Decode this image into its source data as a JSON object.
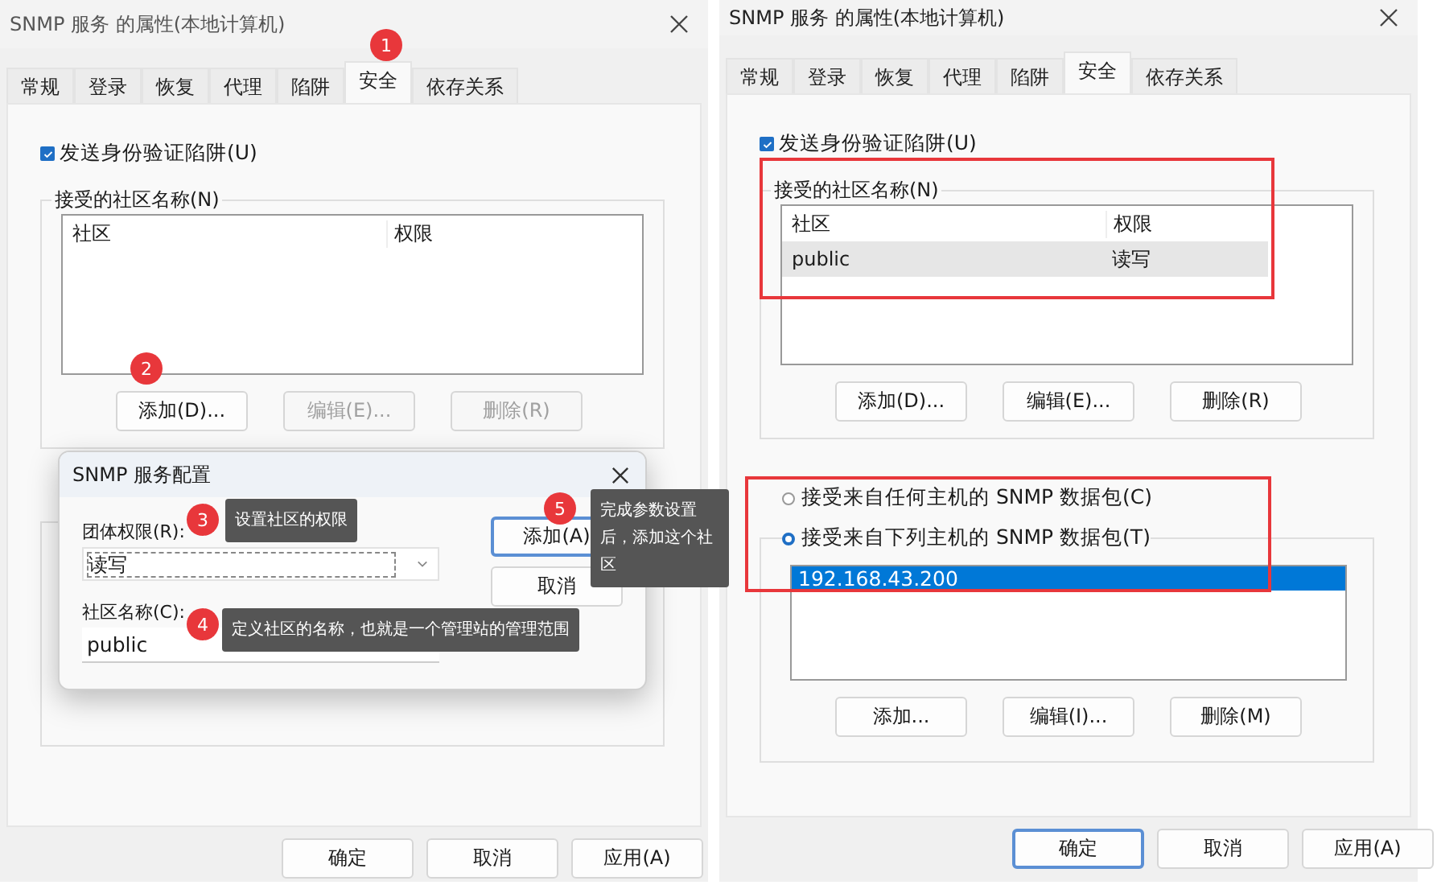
{
  "windows": [
    {
      "title": "SNMP 服务 的属性(本地计算机)",
      "tabs": [
        {
          "label": "常规",
          "selected": false
        },
        {
          "label": "登录",
          "selected": false
        },
        {
          "label": "恢复",
          "selected": false
        },
        {
          "label": "代理",
          "selected": false
        },
        {
          "label": "陷阱",
          "selected": false
        },
        {
          "label": "安全",
          "selected": true
        },
        {
          "label": "依存关系",
          "selected": false
        }
      ],
      "auth_trap": {
        "label": "发送身份验证陷阱(U)",
        "checked": true
      },
      "communities": {
        "label": "接受的社区名称(N)",
        "columns": [
          "社区",
          "权限"
        ]
      },
      "community_buttons": [
        {
          "label": "添加(D)...",
          "disabled": false
        },
        {
          "label": "编辑(E)...",
          "disabled": true
        },
        {
          "label": "删除(R)",
          "disabled": true
        }
      ],
      "footer_buttons": [
        {
          "label": "确定",
          "focused": false
        },
        {
          "label": "取消",
          "focused": false
        },
        {
          "label": "应用(A)",
          "focused": false
        }
      ]
    },
    {
      "title": "SNMP 服务 的属性(本地计算机)",
      "tabs": [
        {
          "label": "常规",
          "selected": false
        },
        {
          "label": "登录",
          "selected": false
        },
        {
          "label": "恢复",
          "selected": false
        },
        {
          "label": "代理",
          "selected": false
        },
        {
          "label": "陷阱",
          "selected": false
        },
        {
          "label": "安全",
          "selected": true
        },
        {
          "label": "依存关系",
          "selected": false
        }
      ],
      "auth_trap": {
        "label": "发送身份验证陷阱(U)",
        "checked": true
      },
      "communities": {
        "label": "接受的社区名称(N)",
        "columns": [
          "社区",
          "权限"
        ],
        "rows": [
          {
            "cells": [
              "public",
              "读写"
            ],
            "selected": true
          }
        ]
      },
      "community_buttons": [
        {
          "label": "添加(D)...",
          "disabled": false
        },
        {
          "label": "编辑(E)...",
          "disabled": false
        },
        {
          "label": "删除(R)",
          "disabled": false
        }
      ],
      "host_filter": {
        "options": [
          {
            "label": "接受来自任何主机的 SNMP 数据包(C)",
            "selected": false
          },
          {
            "label": "接受来自下列主机的 SNMP 数据包(T)",
            "selected": true
          }
        ],
        "hosts": [
          {
            "text": "192.168.43.200",
            "selected": true
          }
        ],
        "buttons": [
          {
            "label": "添加...",
            "disabled": false
          },
          {
            "label": "编辑(I)...",
            "disabled": false
          },
          {
            "label": "删除(M)",
            "disabled": false
          }
        ]
      },
      "footer_buttons": [
        {
          "label": "确定",
          "focused": true
        },
        {
          "label": "取消",
          "focused": false
        },
        {
          "label": "应用(A)",
          "focused": false
        }
      ]
    }
  ],
  "dialog": {
    "title": "SNMP 服务配置",
    "rights_label": "团体权限(R):",
    "rights_value": "读写",
    "name_label": "社区名称(C):",
    "name_value": "public",
    "buttons": [
      {
        "label": "添加(A)",
        "focused": true
      },
      {
        "label": "取消",
        "focused": false
      }
    ]
  },
  "callouts": [
    {
      "number": "1"
    },
    {
      "number": "2"
    },
    {
      "number": "3",
      "text": "设置社区的权限"
    },
    {
      "number": "4",
      "text": "定义社区的名称，也就是一个管理站的管理范围"
    },
    {
      "number": "5",
      "text": "完成参数设置后，添加这个社区"
    }
  ]
}
